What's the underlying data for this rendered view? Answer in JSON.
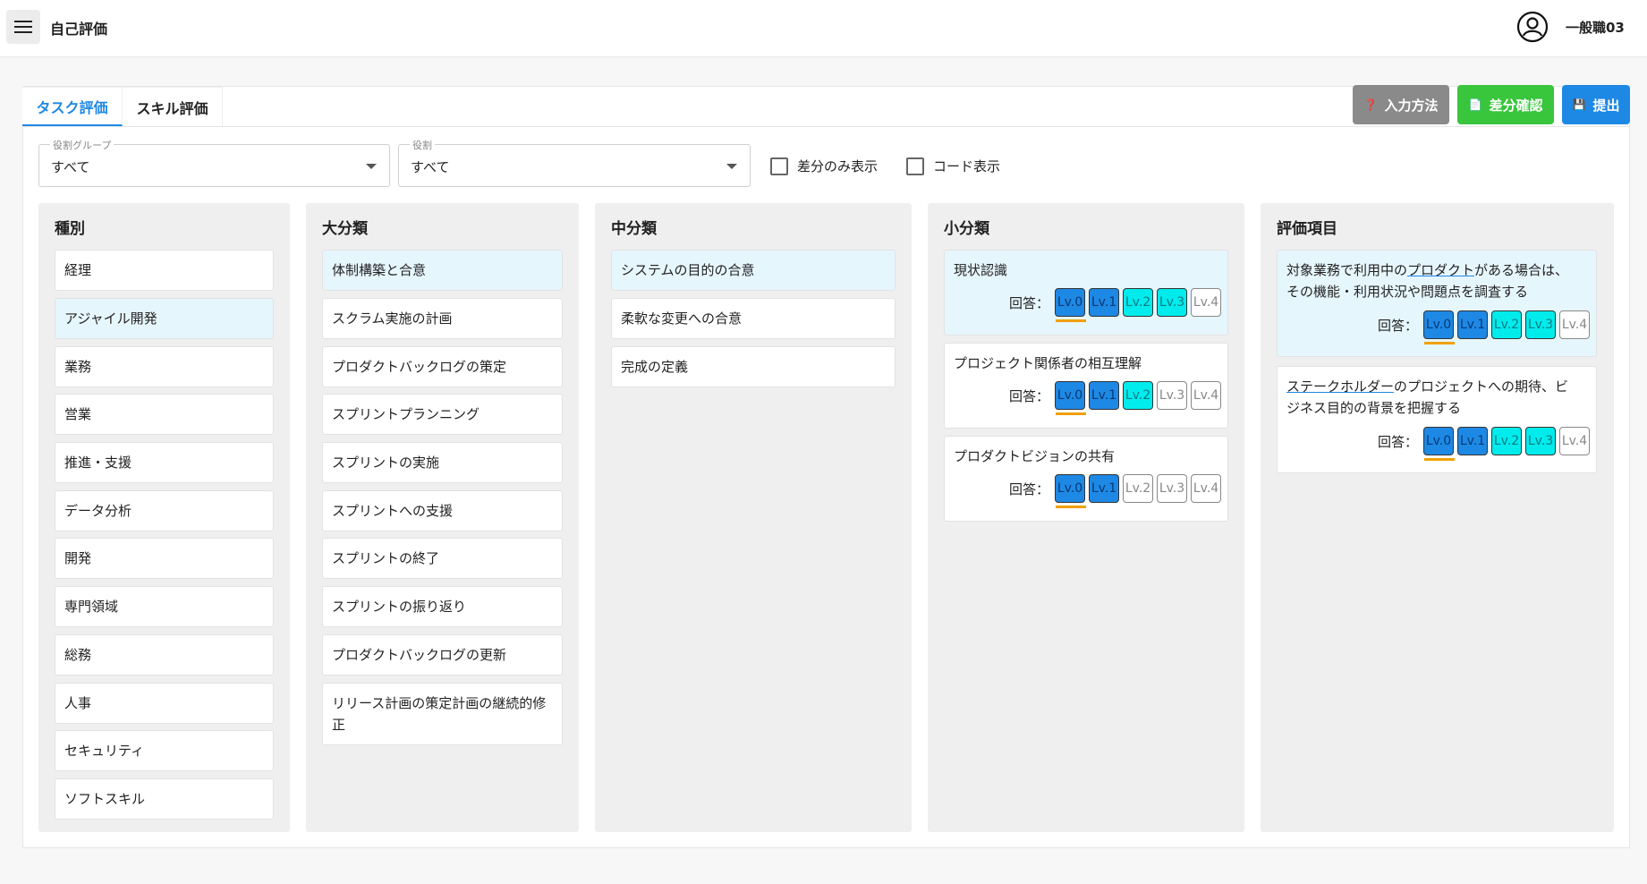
{
  "app": {
    "title": "自己評価",
    "user_name": "一般職03"
  },
  "tabs": [
    {
      "label": "タスク評価",
      "active": true
    },
    {
      "label": "スキル評価",
      "active": false
    }
  ],
  "actions": {
    "help": "入力方法",
    "diff": "差分確認",
    "submit": "提出"
  },
  "filters": {
    "role_group": {
      "label": "役割グループ",
      "value": "すべて"
    },
    "role": {
      "label": "役割",
      "value": "すべて"
    },
    "diff_only": {
      "label": "差分のみ表示",
      "checked": false
    },
    "code_display": {
      "label": "コード表示",
      "checked": false
    }
  },
  "columns": {
    "type": {
      "title": "種別",
      "items": [
        "経理",
        "アジャイル開発",
        "業務",
        "営業",
        "推進・支援",
        "データ分析",
        "開発",
        "専門領域",
        "総務",
        "人事",
        "セキュリティ",
        "ソフトスキル"
      ],
      "selected": 1
    },
    "major": {
      "title": "大分類",
      "items": [
        "体制構築と合意",
        "スクラム実施の計画",
        "プロダクトバックログの策定",
        "スプリントプランニング",
        "スプリントの実施",
        "スプリントへの支援",
        "スプリントの終了",
        "スプリントの振り返り",
        "プロダクトバックログの更新",
        "リリース計画の策定計画の継続的修正"
      ],
      "selected": 0
    },
    "middle": {
      "title": "中分類",
      "items": [
        "システムの目的の合意",
        "柔軟な変更への合意",
        "完成の定義"
      ],
      "selected": 0
    },
    "minor": {
      "title": "小分類",
      "answer_label": "回答：",
      "items": [
        {
          "label": "現状認識",
          "selected": true,
          "levels": [
            "blue",
            "blue",
            "cyan",
            "cyan",
            "empty"
          ]
        },
        {
          "label": "プロジェクト関係者の相互理解",
          "selected": false,
          "levels": [
            "blue",
            "blue",
            "cyan",
            "empty",
            "empty"
          ]
        },
        {
          "label": "プロダクトビジョンの共有",
          "selected": false,
          "levels": [
            "blue",
            "blue",
            "empty",
            "empty",
            "empty"
          ]
        }
      ]
    },
    "evaluation": {
      "title": "評価項目",
      "answer_label": "回答：",
      "items": [
        {
          "label_pre": "対象業務で利用中の",
          "label_link": "プロダクト",
          "label_post1": "がある場合は、",
          "label_line2": "その機能・利用状況や問題点を調査する",
          "selected": true,
          "levels": [
            "blue",
            "blue",
            "cyan",
            "cyan",
            "empty"
          ]
        },
        {
          "label_link": "ステークホルダー",
          "label_post1": "のプロジェクトへの期待、ビ",
          "label_line2": "ジネス目的の背景を把握する",
          "selected": false,
          "levels": [
            "blue",
            "blue",
            "cyan",
            "cyan",
            "empty"
          ]
        }
      ]
    }
  },
  "level_labels": [
    "Lv.0",
    "Lv.1",
    "Lv.2",
    "Lv.3",
    "Lv.4"
  ],
  "colors": {
    "accent": "#1e88e5",
    "success": "#39c53c",
    "neutral": "#8a8a8a",
    "level_blue": "#1e88e5",
    "level_cyan": "#00ecec",
    "selected_bg": "#e6f6fd",
    "underline": "#f0a000"
  }
}
